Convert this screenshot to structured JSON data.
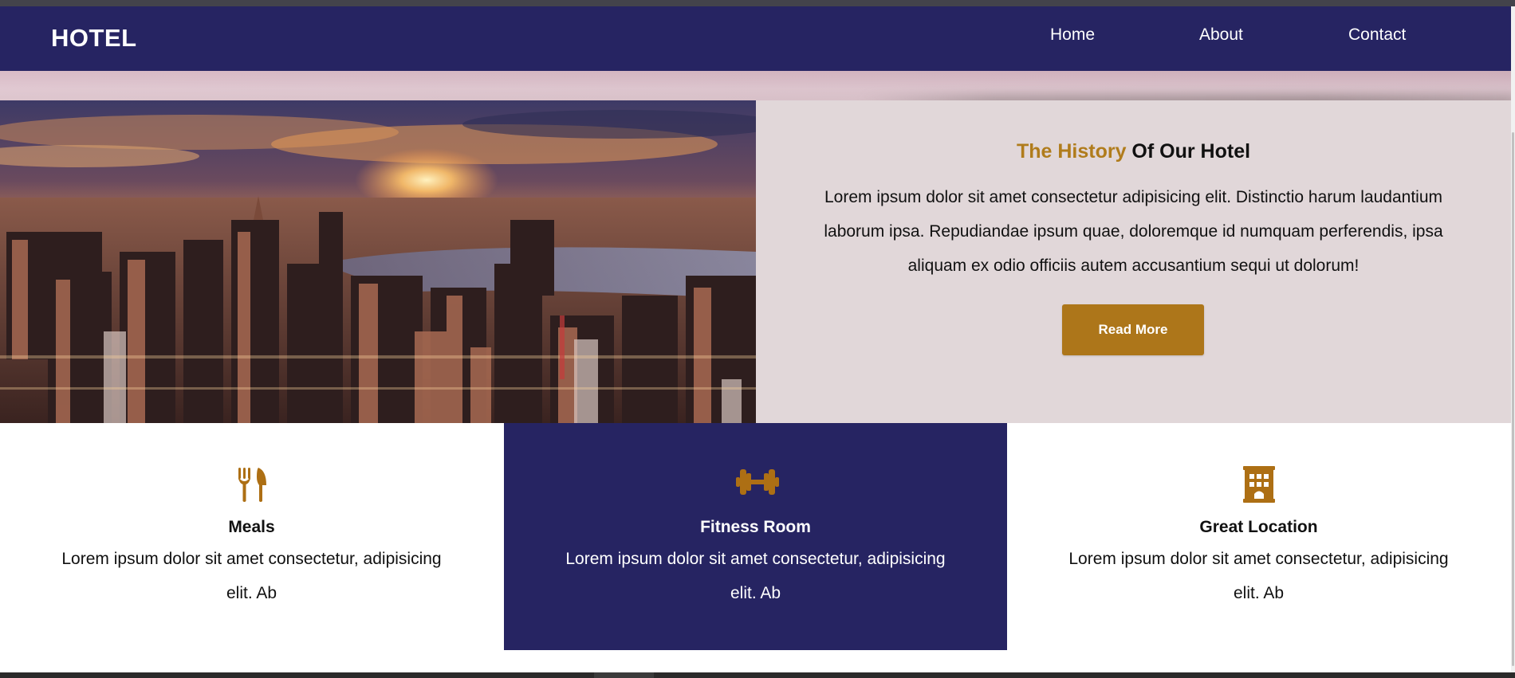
{
  "navbar": {
    "logo": "HOTEL",
    "links": [
      "Home",
      "About",
      "Contact"
    ]
  },
  "about": {
    "title_accent": "The History",
    "title_rest": " Of Our Hotel",
    "paragraph": "Lorem ipsum dolor sit amet consectetur adipisicing elit. Distinctio harum laudantium laborum ipsa. Repudiandae ipsum quae, doloremque id numquam perferendis, ipsa aliquam ex odio officiis autem accusantium sequi ut dolorum!",
    "button_label": "Read More",
    "image": "city-skyline-sunset"
  },
  "features": [
    {
      "icon": "utensils-icon",
      "title": "Meals",
      "description": "Lorem ipsum dolor sit amet consectetur, adipisicing elit. Ab"
    },
    {
      "icon": "dumbbell-icon",
      "title": "Fitness Room",
      "description": "Lorem ipsum dolor sit amet consectetur, adipisicing elit. Ab"
    },
    {
      "icon": "building-icon",
      "title": "Great Location",
      "description": "Lorem ipsum dolor sit amet consectetur, adipisicing elit. Ab"
    }
  ],
  "colors": {
    "nav_bg": "#262462",
    "accent": "#b07c1c",
    "button": "#ad761a",
    "about_bg": "#e1d7d9",
    "white": "#ffffff"
  }
}
